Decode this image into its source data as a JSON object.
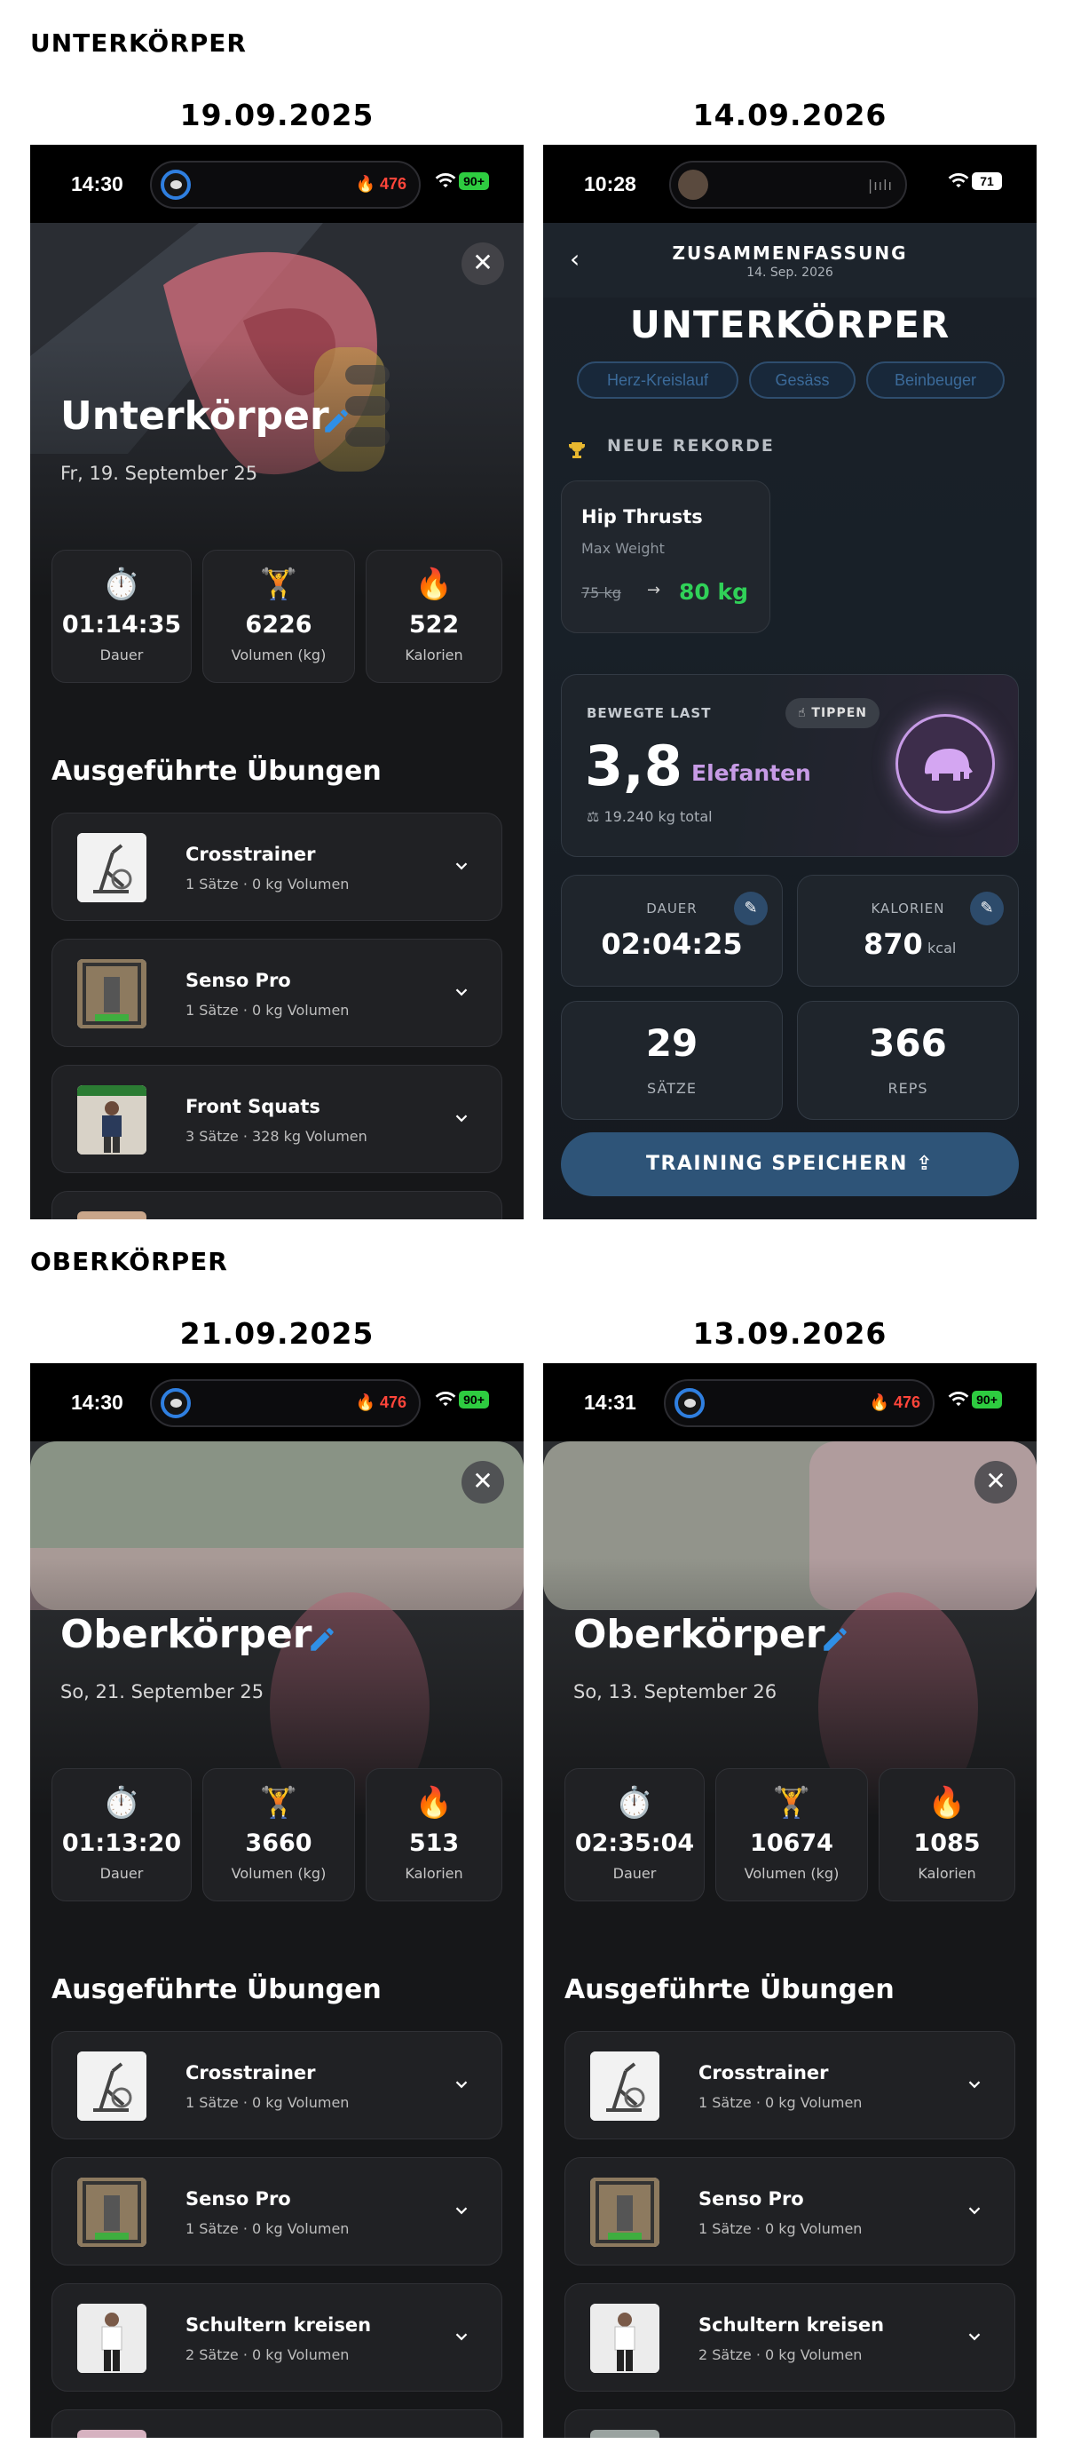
{
  "sections": {
    "lower": "UNTERKÖRPER",
    "upper": "OBERKÖRPER"
  },
  "phones": [
    {
      "date_heading": "19.09.2025",
      "status": {
        "time": "14:30",
        "calories": "476",
        "battery": "90+"
      },
      "title": "Unterkörper",
      "date": "Fr, 19. September 25",
      "stats": [
        {
          "icon": "stopwatch-icon",
          "value": "01:14:35",
          "label": "Dauer"
        },
        {
          "icon": "weightlifter-icon",
          "value": "6226",
          "label": "Volumen (kg)"
        },
        {
          "icon": "fire-icon",
          "value": "522",
          "label": "Kalorien"
        }
      ],
      "exercises_heading": "Ausgeführte Übungen",
      "exercises": [
        {
          "name": "Crosstrainer",
          "meta": "1 Sätze  ·  0 kg Volumen"
        },
        {
          "name": "Senso Pro",
          "meta": "1 Sätze  ·  0 kg Volumen"
        },
        {
          "name": "Front Squats",
          "meta": "3 Sätze  ·  328 kg Volumen"
        }
      ]
    },
    {
      "date_heading": "14.09.2026",
      "status": {
        "time": "10:28",
        "battery": "71"
      },
      "header": {
        "title": "ZUSAMMENFASSUNG",
        "subtitle": "14. Sep. 2026"
      },
      "workout_title": "UNTERKÖRPER",
      "muscle_chips": [
        "Herz-Kreislauf",
        "Gesäss",
        "Beinbeuger"
      ],
      "records_label": "NEUE REKORDE",
      "record": {
        "exercise": "Hip Thrusts",
        "type": "Max Weight",
        "old": "75 kg",
        "new": "80 kg"
      },
      "moved_load": {
        "label": "BEWEGTE LAST",
        "tap": "TIPPEN",
        "value": "3,8",
        "unit": "Elefanten",
        "total": "19.240 kg total"
      },
      "metrics": [
        {
          "label": "DAUER",
          "value": "02:04:25",
          "unit": ""
        },
        {
          "label": "KALORIEN",
          "value": "870",
          "unit": "kcal"
        },
        {
          "label": "SÄTZE",
          "value": "29"
        },
        {
          "label": "REPS",
          "value": "366"
        }
      ],
      "save_button": "TRAINING SPEICHERN"
    },
    {
      "date_heading": "21.09.2025",
      "status": {
        "time": "14:30",
        "calories": "476",
        "battery": "90+"
      },
      "title": "Oberkörper",
      "date": "So, 21. September 25",
      "stats": [
        {
          "icon": "stopwatch-icon",
          "value": "01:13:20",
          "label": "Dauer"
        },
        {
          "icon": "weightlifter-icon",
          "value": "3660",
          "label": "Volumen (kg)"
        },
        {
          "icon": "fire-icon",
          "value": "513",
          "label": "Kalorien"
        }
      ],
      "exercises_heading": "Ausgeführte Übungen",
      "exercises": [
        {
          "name": "Crosstrainer",
          "meta": "1 Sätze  ·  0 kg Volumen"
        },
        {
          "name": "Senso Pro",
          "meta": "1 Sätze  ·  0 kg Volumen"
        },
        {
          "name": "Schultern kreisen",
          "meta": "2 Sätze  ·  0 kg Volumen"
        }
      ]
    },
    {
      "date_heading": "13.09.2026",
      "status": {
        "time": "14:31",
        "calories": "476",
        "battery": "90+"
      },
      "title": "Oberkörper",
      "date": "So, 13. September 26",
      "stats": [
        {
          "icon": "stopwatch-icon",
          "value": "02:35:04",
          "label": "Dauer"
        },
        {
          "icon": "weightlifter-icon",
          "value": "10674",
          "label": "Volumen (kg)"
        },
        {
          "icon": "fire-icon",
          "value": "1085",
          "label": "Kalorien"
        }
      ],
      "exercises_heading": "Ausgeführte Übungen",
      "exercises": [
        {
          "name": "Crosstrainer",
          "meta": "1 Sätze  ·  0 kg Volumen"
        },
        {
          "name": "Senso Pro",
          "meta": "1 Sätze  ·  0 kg Volumen"
        },
        {
          "name": "Schultern kreisen",
          "meta": "2 Sätze  ·  0 kg Volumen"
        }
      ]
    }
  ],
  "colors": {
    "accent_blue": "#2f8fe6",
    "record_green": "#30d158",
    "elephant_purple": "#c79be6",
    "fire_red": "#ff453a"
  }
}
